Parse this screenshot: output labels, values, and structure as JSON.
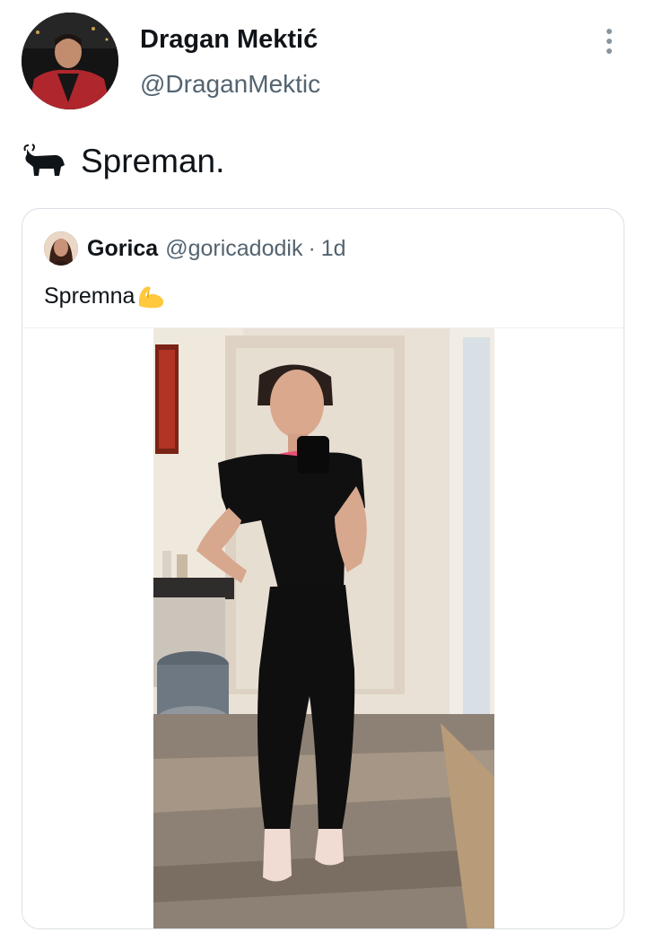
{
  "author": {
    "name": "Dragan Mektić",
    "handle": "@DraganMektic",
    "avatar_icon": "profile-photo"
  },
  "tweet": {
    "emoji_icon": "bull-emoji",
    "text": "Spreman."
  },
  "quoted_tweet": {
    "name": "Gorica",
    "handle": "@goricadodik",
    "separator": "·",
    "time": "1d",
    "text": "Spremna",
    "emoji_icon": "flexed-biceps-emoji",
    "media_icon": "mirror-selfie-photo"
  },
  "colors": {
    "text_primary": "#0f1419",
    "text_secondary": "#536471",
    "border": "#d9e0e5"
  }
}
